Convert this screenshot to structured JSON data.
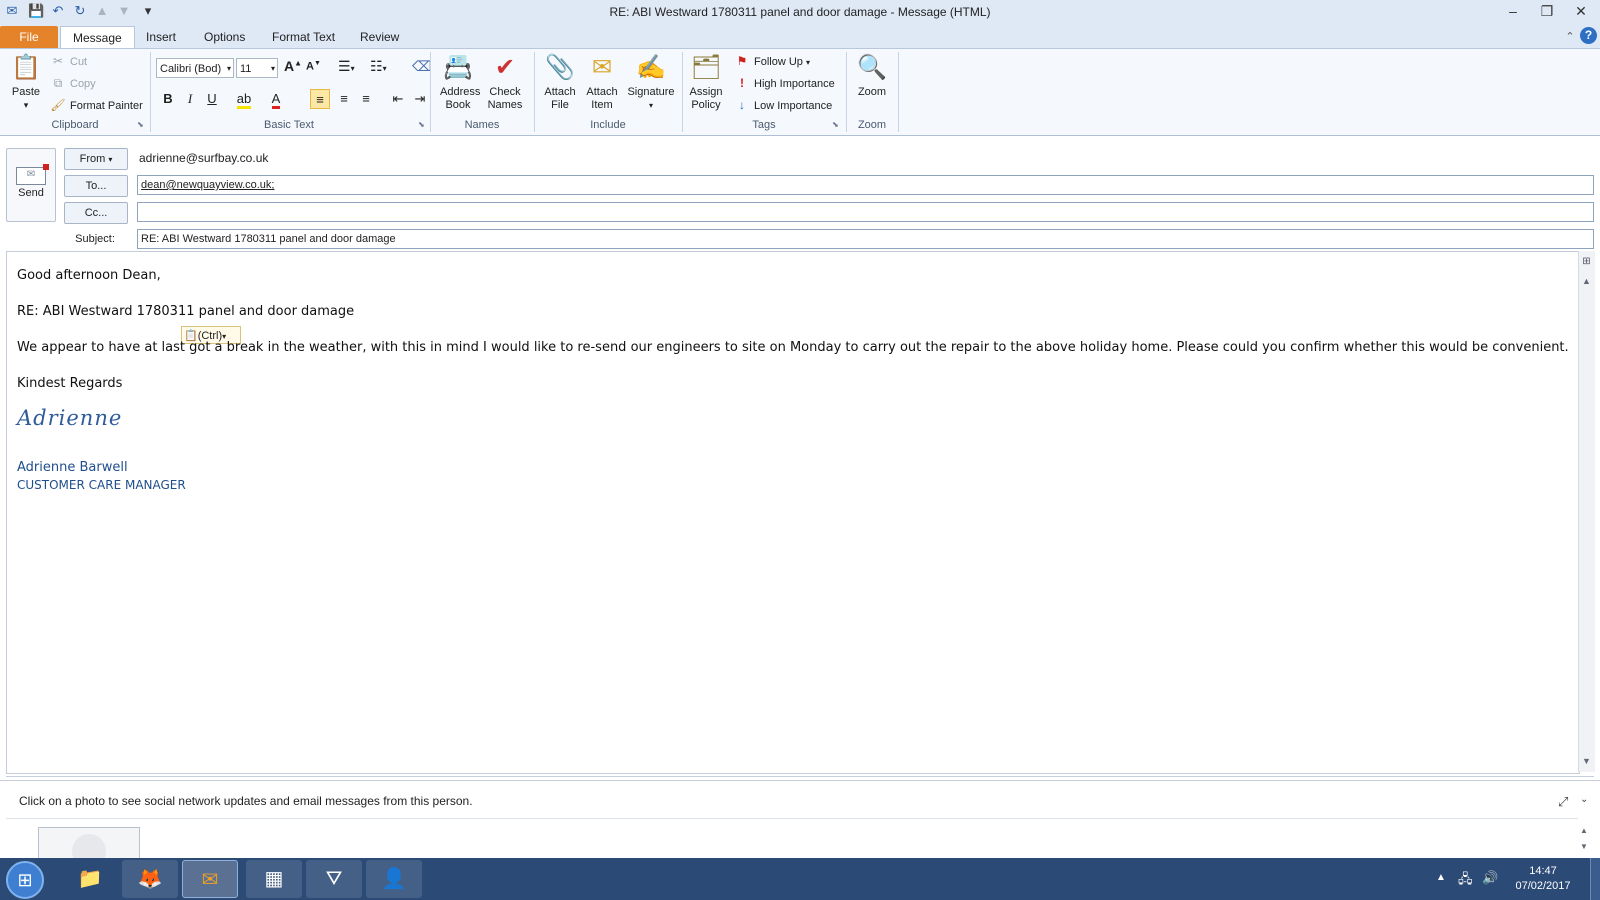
{
  "window": {
    "title": "RE: ABI Westward 1780311   panel and door damage  -  Message (HTML)",
    "controls": {
      "minimize": "–",
      "restore": "❐",
      "close": "✕"
    }
  },
  "qat": {
    "customize": "▾"
  },
  "tabs": [
    "File",
    "Message",
    "Insert",
    "Options",
    "Format Text",
    "Review"
  ],
  "ribbon": {
    "clipboard": {
      "paste": "Paste",
      "cut": "Cut",
      "copy": "Copy",
      "format_painter": "Format Painter",
      "label": "Clipboard"
    },
    "basic_text": {
      "font": "Calibri (Bod)",
      "size": "11",
      "bold": "B",
      "italic": "I",
      "underline": "U",
      "label": "Basic Text"
    },
    "names": {
      "address_book": "Address Book",
      "check_names": "Check Names",
      "label": "Names"
    },
    "include": {
      "attach_file": "Attach File",
      "attach_item": "Attach Item",
      "signature": "Signature",
      "label": "Include"
    },
    "tags": {
      "assign_policy": "Assign Policy",
      "follow_up": "Follow Up",
      "high_importance": "High Importance",
      "low_importance": "Low Importance",
      "label": "Tags"
    },
    "zoom": {
      "zoom": "Zoom",
      "label": "Zoom"
    }
  },
  "header": {
    "send": "Send",
    "from_button": "From",
    "from_value": "adrienne@surfbay.co.uk",
    "to_button": "To...",
    "to_value": "dean@newquayview.co.uk;",
    "cc_button": "Cc...",
    "cc_value": "",
    "subject_label": "Subject:",
    "subject_value": "RE: ABI Westward 1780311   panel and door damage"
  },
  "body": {
    "greeting": "Good afternoon Dean,",
    "reference": "RE: ABI Westward 1780311 panel and door damage",
    "paste_options": "(Ctrl)",
    "paragraph": "We appear to have at last got a break in the weather, with this in mind I would like to re-send our engineers to site on Monday to carry out the repair to the above holiday home.  Please could you confirm whether this would be convenient.",
    "closing": "Kindest Regards",
    "signature_script": "Adrienne",
    "signature_name": "Adrienne Barwell",
    "signature_title": "CUSTOMER CARE MANAGER"
  },
  "people_pane": {
    "hint": "Click on a photo to see social network updates and email messages from this person."
  },
  "taskbar": {
    "time": "14:47",
    "date": "07/02/2017"
  },
  "colors": {
    "file_tab": "#e5832a",
    "signature_blue": "#1f4e8c",
    "taskbar": "#2c4a76"
  }
}
